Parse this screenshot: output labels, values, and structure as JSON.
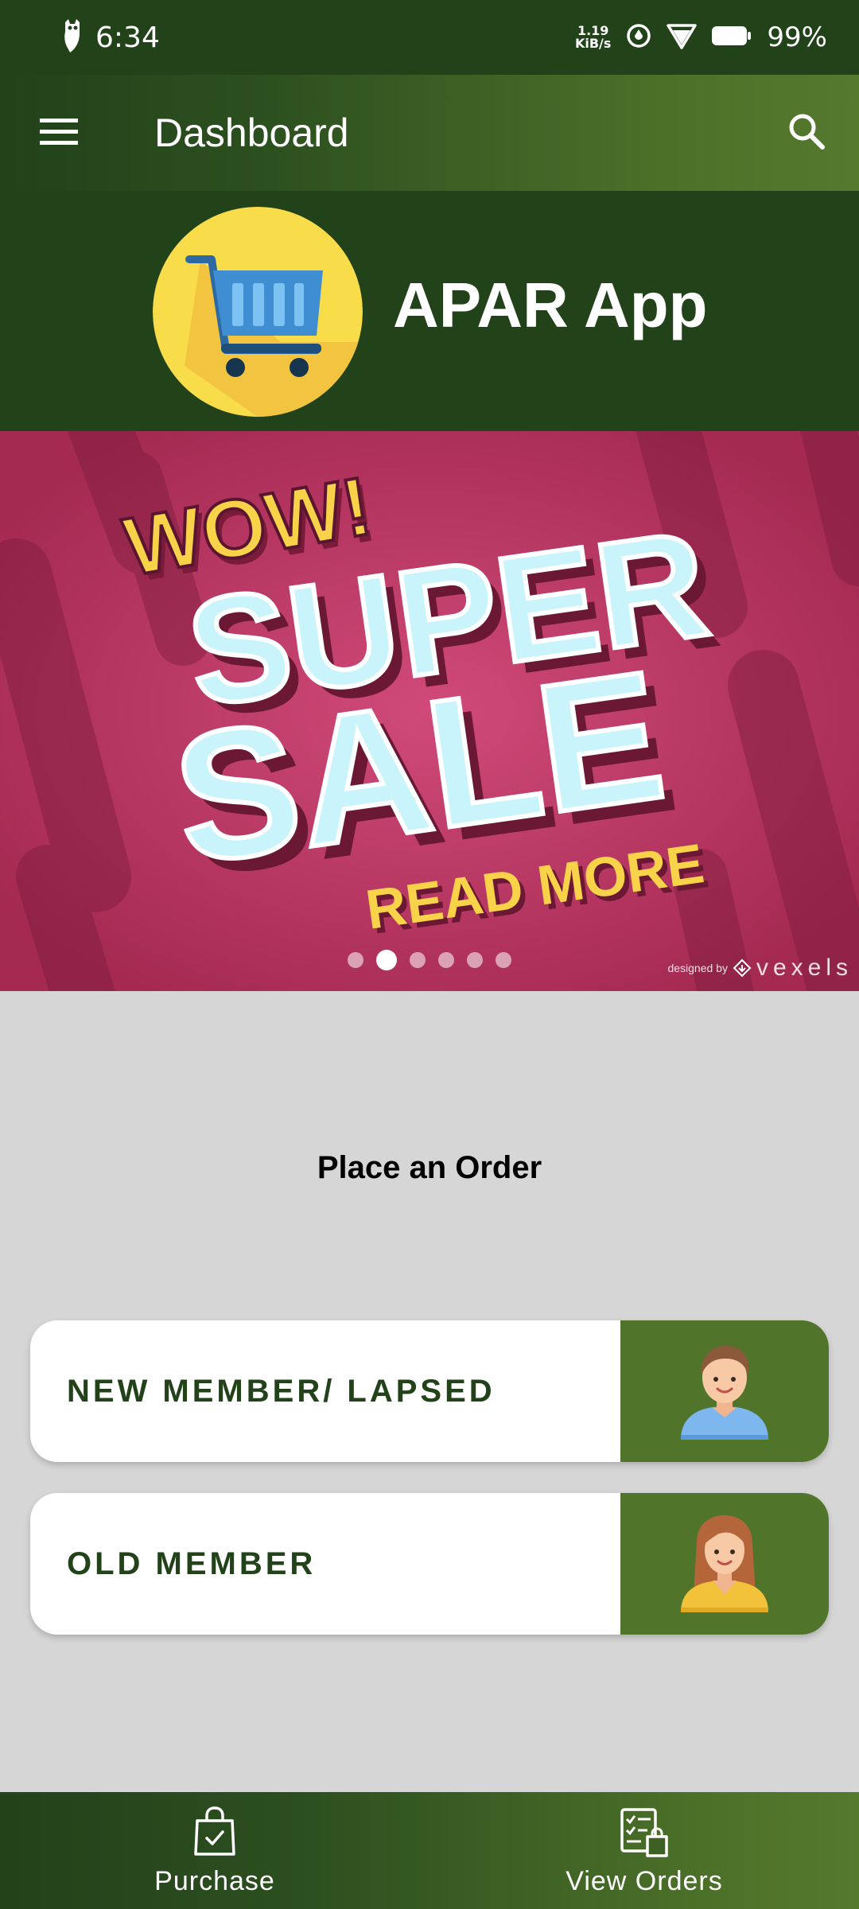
{
  "status_bar": {
    "time": "6:34",
    "net_speed_value": "1.19",
    "net_speed_unit": "KiB/s",
    "battery": "99%"
  },
  "app_bar": {
    "title": "Dashboard"
  },
  "header": {
    "brand": "APAR App"
  },
  "banner": {
    "line1": "WOW!",
    "line2": "SUPER",
    "line3": "SALE",
    "line4": "READ MORE",
    "credit_prefix": "designed by",
    "credit_brand": "vexels",
    "dot_count": 6,
    "active_dot": 2
  },
  "main": {
    "section_title": "Place an Order",
    "cards": [
      {
        "label": "NEW MEMBER/ LAPSED",
        "icon": "male-avatar-icon"
      },
      {
        "label": "OLD MEMBER",
        "icon": "female-avatar-icon"
      }
    ]
  },
  "bottom_nav": {
    "items": [
      {
        "label": "Purchase",
        "icon": "shopping-bag-check-icon"
      },
      {
        "label": "View Orders",
        "icon": "orders-list-icon"
      }
    ]
  },
  "colors": {
    "primary_dark": "#22421a",
    "accent_green": "#51742b",
    "banner_pink": "#b8325c",
    "logo_yellow": "#f9dc4a"
  }
}
